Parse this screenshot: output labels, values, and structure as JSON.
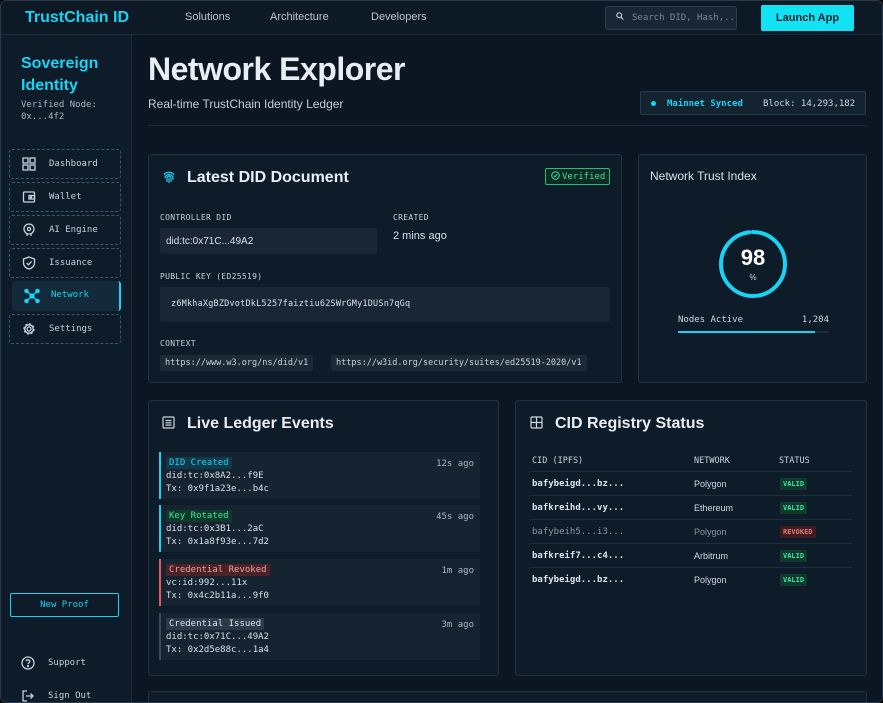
{
  "brand": "TrustChain ID",
  "topnav": [
    "Solutions",
    "Architecture",
    "Developers"
  ],
  "search": {
    "placeholder": "Search DID, Hash,..."
  },
  "launch_label": "Launch App",
  "sidebar": {
    "title": "Sovereign Identity",
    "node_label": "Verified Node:",
    "node_id": "0x...4f2",
    "items": [
      {
        "label": "Dashboard",
        "icon": "grid-icon"
      },
      {
        "label": "Wallet",
        "icon": "wallet-icon"
      },
      {
        "label": "AI Engine",
        "icon": "brain-icon"
      },
      {
        "label": "Issuance",
        "icon": "shield-icon"
      },
      {
        "label": "Network",
        "icon": "network-icon",
        "active": true
      },
      {
        "label": "Settings",
        "icon": "gear-icon"
      }
    ],
    "new_proof": "New Proof",
    "support": "Support",
    "sign_out": "Sign Out"
  },
  "header": {
    "title": "Network Explorer",
    "subtitle": "Real-time TrustChain Identity Ledger",
    "sync_status": "Mainnet Synced",
    "block": "Block: 14,293,182"
  },
  "did_doc": {
    "title": "Latest DID Document",
    "badge": "Verified",
    "controller_label": "CONTROLLER DID",
    "controller_value": "did:tc:0x71C...49A2",
    "created_label": "CREATED",
    "created_value": "2 mins ago",
    "pubkey_label": "PUBLIC KEY (ED25519)",
    "pubkey_value": "z6MkhaXgBZDvotDkL5257faiztiu62SWrGMy1DUSn7qGq",
    "context_label": "CONTEXT",
    "contexts": [
      "https://www.w3.org/ns/did/v1",
      "https://w3id.org/security/suites/ed25519-2020/v1"
    ]
  },
  "trust": {
    "title": "Network Trust Index",
    "value": "98",
    "unit": "%",
    "percent": 98,
    "nodes_label": "Nodes Active",
    "nodes_value": "1,204",
    "nodes_fill": 0.91,
    "accent": "#19d3f5"
  },
  "ledger": {
    "title": "Live Ledger Events",
    "events": [
      {
        "tag": "DID Created",
        "line1": "did:tc:0x8A2...f9E",
        "line2": "Tx: 0x9f1a23e...b4c",
        "time": "12s ago",
        "kind": "created"
      },
      {
        "tag": "Key Rotated",
        "line1": "did:tc:0x3B1...2aC",
        "line2": "Tx: 0x1a8f93e...7d2",
        "time": "45s ago",
        "kind": "rotated"
      },
      {
        "tag": "Credential Revoked",
        "line1": "vc:id:992...11x",
        "line2": "Tx: 0x4c2b11a...9f0",
        "time": "1m ago",
        "kind": "revoked"
      },
      {
        "tag": "Credential Issued",
        "line1": "did:tc:0x71C...49A2",
        "line2": "Tx: 0x2d5e88c...1a4",
        "time": "3m ago",
        "kind": "issued"
      }
    ]
  },
  "registry": {
    "title": "CID Registry Status",
    "columns": [
      "CID (IPFS)",
      "NETWORK",
      "STATUS"
    ],
    "rows": [
      {
        "cid": "bafybeigd...bz...",
        "network": "Polygon",
        "status": "VALID"
      },
      {
        "cid": "bafkreihd...vy...",
        "network": "Ethereum",
        "status": "VALID"
      },
      {
        "cid": "bafybeih5...i3...",
        "network": "Polygon",
        "status": "REVOKED"
      },
      {
        "cid": "bafkreif7...c4...",
        "network": "Arbitrum",
        "status": "VALID"
      },
      {
        "cid": "bafybeigd...bz...",
        "network": "Polygon",
        "status": "VALID"
      }
    ]
  }
}
